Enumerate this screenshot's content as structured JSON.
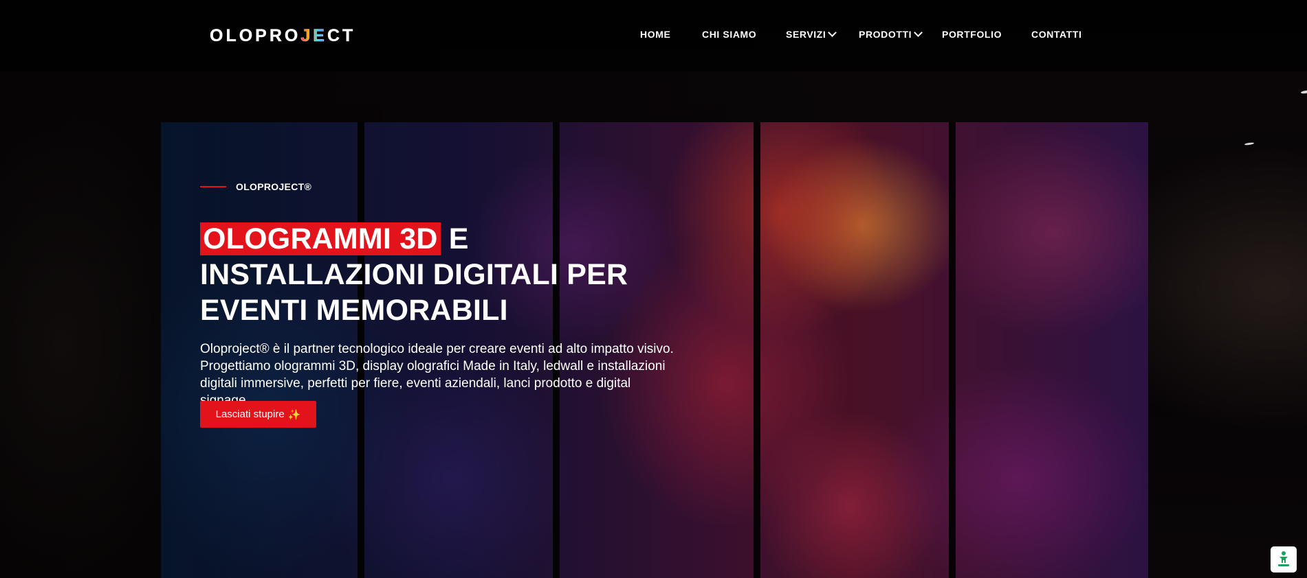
{
  "header": {
    "logo_text_pre": "OLOPRO",
    "logo_text_mid": "JE",
    "logo_text_post": "CT",
    "nav": {
      "home": "HOME",
      "chi_siamo": "CHI SIAMO",
      "servizi": "SERVIZI",
      "prodotti": "PRODOTTI",
      "portfolio": "PORTFOLIO",
      "contatti": "CONTATTI"
    }
  },
  "hero": {
    "eyebrow": "OLOPROJECT®",
    "headline_highlight": "OLOGRAMMI 3D",
    "headline_rest": " E INSTALLAZIONI DIGITALI PER EVENTI MEMORABILI",
    "lead": "Oloproject® è il partner tecnologico ideale per creare eventi ad alto impatto visivo. Progettiamo ologrammi 3D, display olografici Made in Italy, ledwall e installazioni digitali immersive, perfetti per fiere, eventi aziendali, lanci prodotto e digital signage.",
    "cta_label": "Lasciati stupire",
    "cta_emoji": "✨"
  },
  "icons": {
    "dropdown": "chevron-down-icon",
    "cta": "sparkles-icon",
    "badge": "accessibility-icon"
  },
  "colors": {
    "accent": "#e3131b",
    "text": "#ffffff",
    "header_bg": "#000000"
  }
}
